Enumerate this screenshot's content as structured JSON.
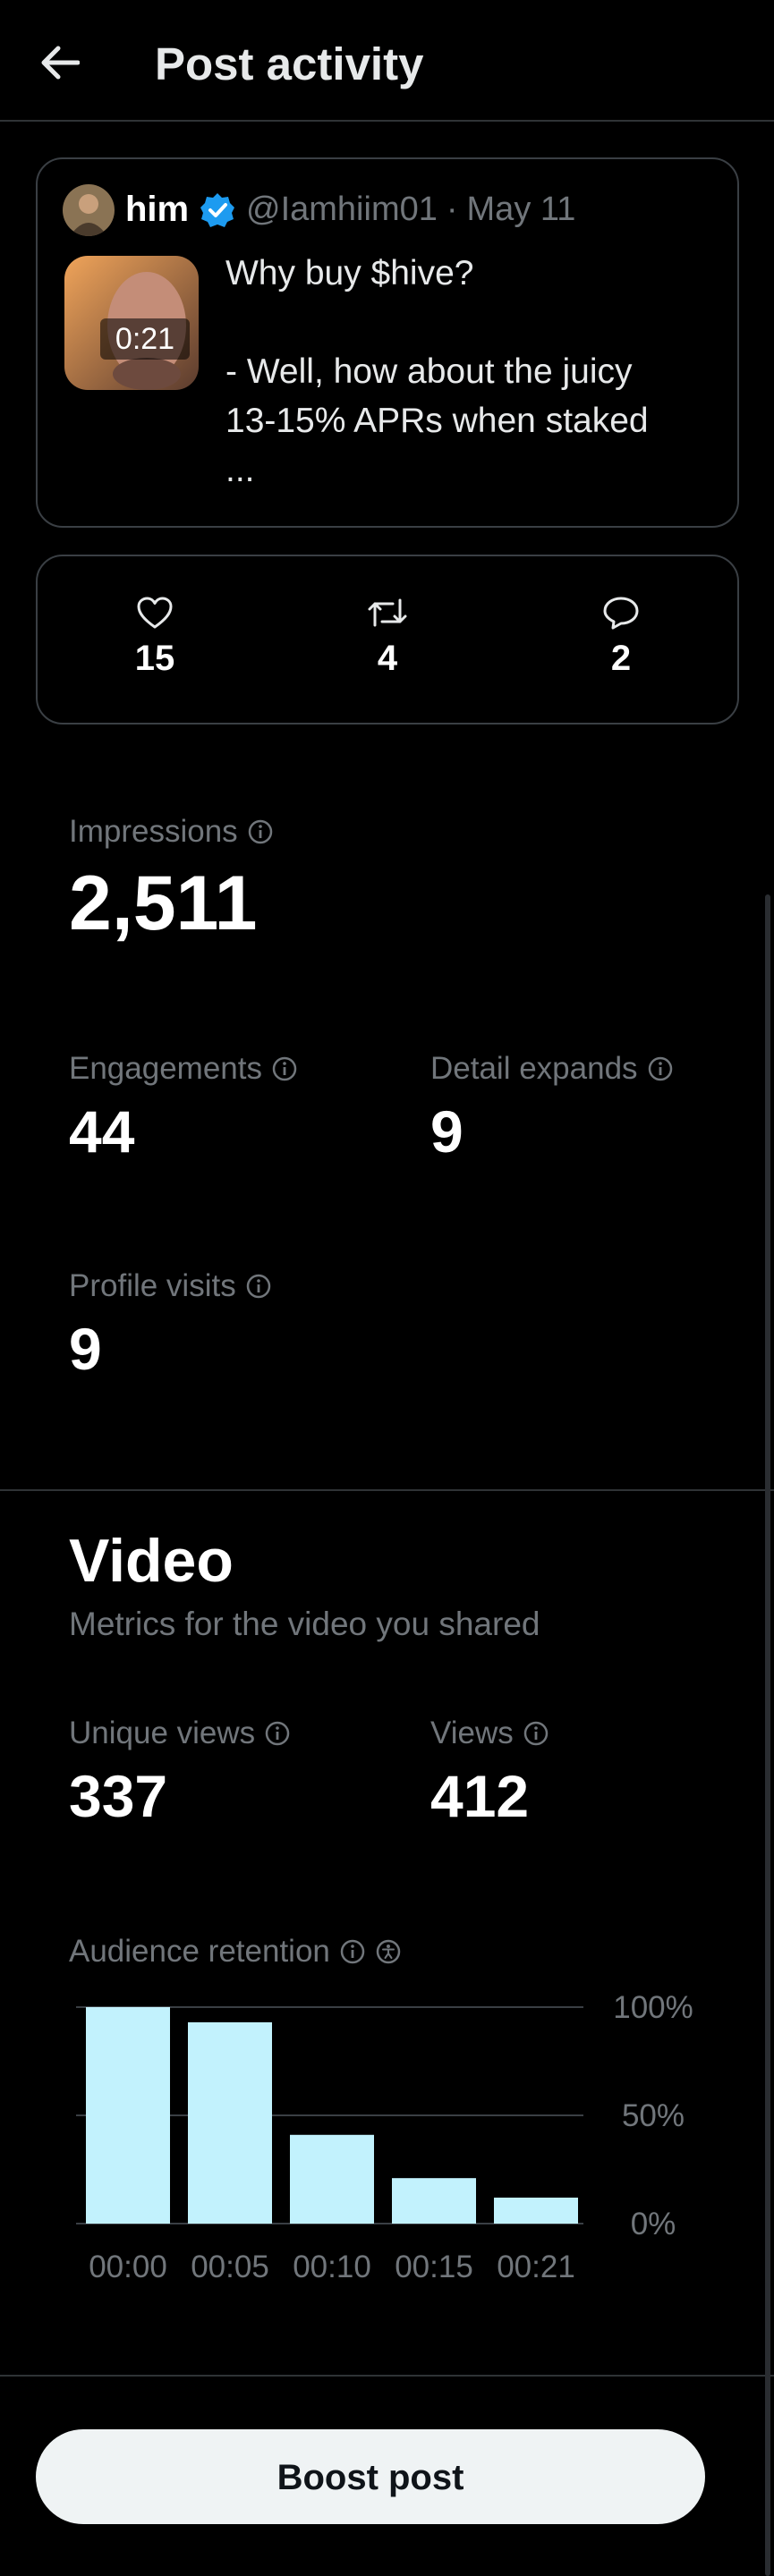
{
  "header": {
    "title": "Post activity",
    "back_icon": "arrow-left-icon"
  },
  "post": {
    "author_name": "him",
    "handle": "@Iamhiim01",
    "date": "May 11",
    "video_duration": "0:21",
    "text_lines": [
      "Why buy $hive?",
      "- Well, how about the juicy",
      "13-15% APRs when staked",
      "..."
    ]
  },
  "engagement": {
    "likes": "15",
    "reposts": "4",
    "replies": "2"
  },
  "metrics": {
    "impressions_label": "Impressions",
    "impressions_value": "2,511",
    "engagements_label": "Engagements",
    "engagements_value": "44",
    "detail_expands_label": "Detail expands",
    "detail_expands_value": "9",
    "profile_visits_label": "Profile visits",
    "profile_visits_value": "9"
  },
  "video": {
    "title": "Video",
    "subtitle": "Metrics for the video you shared",
    "unique_views_label": "Unique views",
    "unique_views_value": "337",
    "views_label": "Views",
    "views_value": "412",
    "retention_label": "Audience retention"
  },
  "chart_data": {
    "type": "bar",
    "categories": [
      "00:00",
      "00:05",
      "00:10",
      "00:15",
      "00:21"
    ],
    "values": [
      100,
      93,
      41,
      21,
      12
    ],
    "ylim": [
      0,
      100
    ],
    "y_ticks": [
      "100%",
      "50%",
      "0%"
    ],
    "bar_color": "#c2f2fd",
    "grid": true
  },
  "footer": {
    "boost_label": "Boost post"
  },
  "colors": {
    "accent_blue": "#1d9bf0",
    "muted": "#71767b"
  }
}
